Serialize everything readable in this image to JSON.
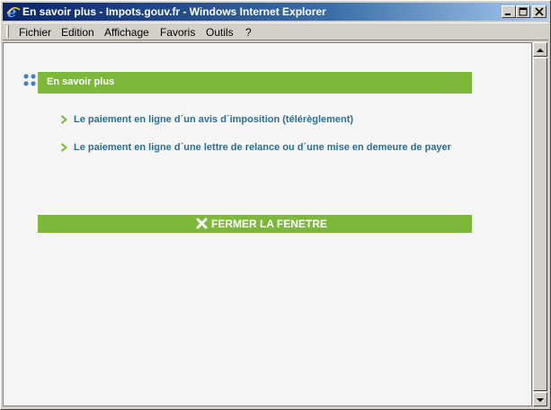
{
  "window": {
    "title": "En savoir plus - Impots.gouv.fr - Windows Internet Explorer"
  },
  "menu": [
    "Fichier",
    "Edition",
    "Affichage",
    "Favoris",
    "Outils",
    "?"
  ],
  "page": {
    "header": "En savoir plus",
    "links": [
      "Le paiement en ligne d´un avis d´imposition (télérèglement)",
      "Le paiement en ligne d´une lettre de relance ou d´une mise en demeure de payer"
    ],
    "close_label": "FERMER LA FENETRE"
  },
  "colors": {
    "accent_green": "#7db838",
    "link_blue": "#2a6f94",
    "dots_blue": "#3b7fc4"
  },
  "icons": {
    "browser": "ie-icon",
    "bullet": "chevron-right-icon",
    "close": "x-icon"
  }
}
